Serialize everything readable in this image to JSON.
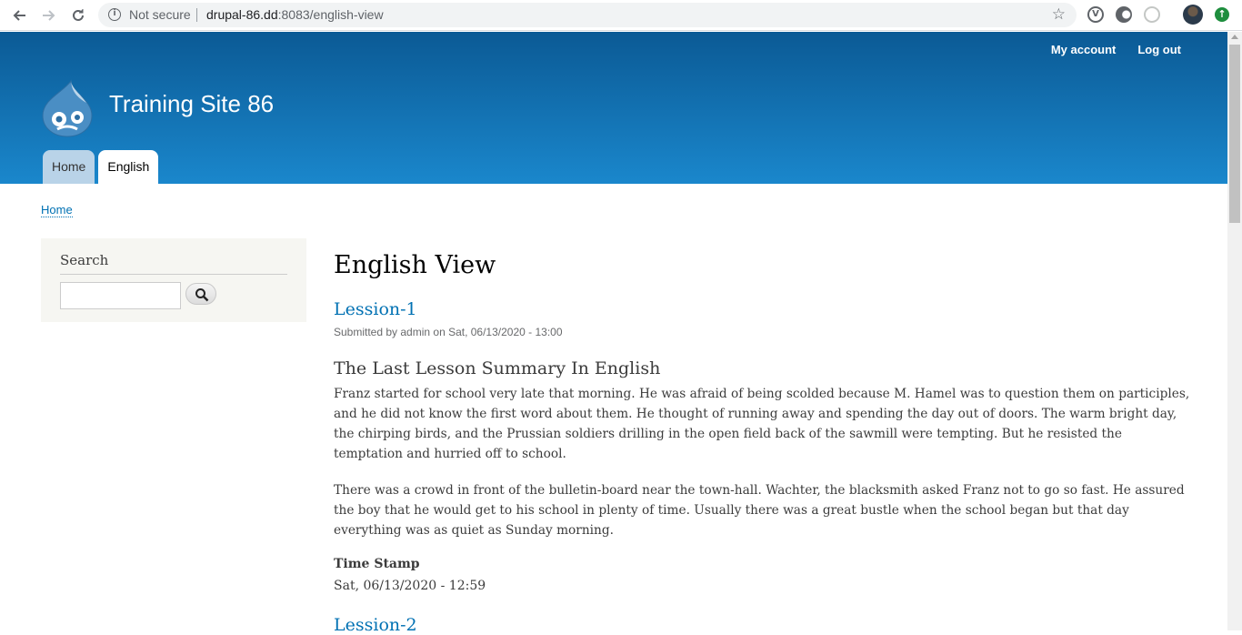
{
  "browser": {
    "security_label": "Not secure",
    "url_host": "drupal-86.dd",
    "url_rest": ":8083/english-view",
    "extension_1_letter": "V",
    "update_glyph": "↑",
    "star_glyph": "☆",
    "info_glyph": "i"
  },
  "header": {
    "secondary_menu": [
      "My account",
      "Log out"
    ],
    "site_name": "Training Site 86",
    "tabs": [
      {
        "label": "Home",
        "active": false
      },
      {
        "label": "English",
        "active": true
      }
    ]
  },
  "breadcrumb": {
    "home": "Home"
  },
  "sidebar": {
    "search_title": "Search",
    "search_value": ""
  },
  "main": {
    "page_title": "English View",
    "nodes": [
      {
        "title": "Lession-1",
        "submitted": "Submitted by admin on Sat, 06/13/2020 - 13:00",
        "summary_heading": "The Last Lesson Summary In English",
        "paragraphs": [
          "Franz started for school very late that morning. He was afraid of being scolded because M. Hamel was to question them on participles, and he did not know the first word about them. He thought of running away and spending the day out of doors. The warm bright day, the chirping birds, and the Prussian soldiers drilling in the open field back of the sawmill were tempting. But he resisted the temptation and hurried off to school.",
          "There was a crowd in front of the bulletin-board near the town-hall. Wachter, the blacksmith asked Franz not to go so fast. He assured the boy that he would get to his school in plenty of time. Usually there was a great bustle when the school began but that day everything was as quiet as Sunday morning."
        ],
        "field_label": "Time Stamp",
        "field_value": "Sat, 06/13/2020 - 12:59"
      },
      {
        "title": "Lession-2"
      }
    ]
  },
  "colors": {
    "header_top": "#0b5a95",
    "header_bottom": "#1a87cc",
    "link": "#0071b3",
    "sidebar_bg": "#f6f6f2"
  }
}
